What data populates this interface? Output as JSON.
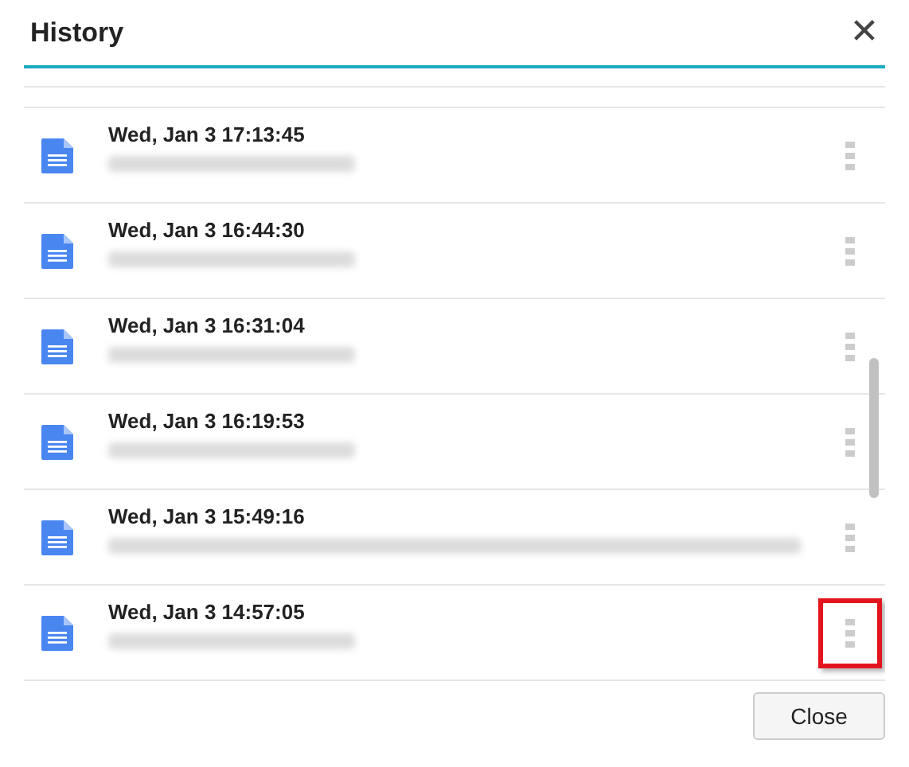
{
  "dialog": {
    "title": "History",
    "close_icon": "✕"
  },
  "entries": [
    {
      "time": "Wed, Jan 3 17:13:45",
      "redacted": true,
      "redacted_wide": false,
      "highlighted": false
    },
    {
      "time": "Wed, Jan 3 16:44:30",
      "redacted": true,
      "redacted_wide": false,
      "highlighted": false
    },
    {
      "time": "Wed, Jan 3 16:31:04",
      "redacted": true,
      "redacted_wide": false,
      "highlighted": false
    },
    {
      "time": "Wed, Jan 3 16:19:53",
      "redacted": true,
      "redacted_wide": false,
      "highlighted": false
    },
    {
      "time": "Wed, Jan 3 15:49:16",
      "redacted": true,
      "redacted_wide": true,
      "highlighted": false
    },
    {
      "time": "Wed, Jan 3 14:57:05",
      "redacted": true,
      "redacted_wide": false,
      "highlighted": true
    }
  ],
  "buttons": [
    "Close"
  ]
}
